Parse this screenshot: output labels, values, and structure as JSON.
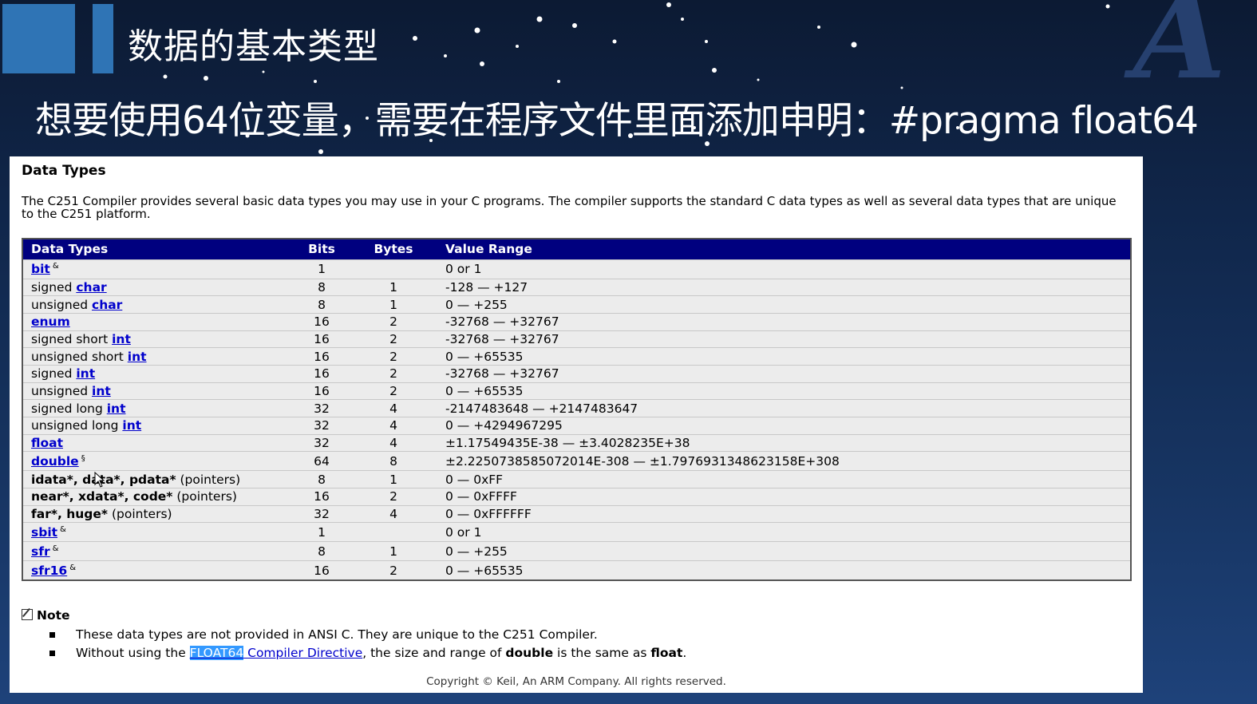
{
  "slide": {
    "title": "数据的基本类型",
    "subtitle": "想要使用64位变量，需要在程序文件里面添加申明：#pragma float64"
  },
  "doc": {
    "heading": "Data Types",
    "intro": "The C251 Compiler provides several basic data types you may use in your C programs. The compiler supports the standard C data types as well as several data types that are unique to the C251 platform.",
    "columns": [
      "Data Types",
      "Bits",
      "Bytes",
      "Value Range"
    ],
    "rows": [
      {
        "pre": "",
        "link": "bit",
        "post": "",
        "sup": "&",
        "bits": "1",
        "bytes": "",
        "range": "0 or 1"
      },
      {
        "pre": "signed ",
        "link": "char",
        "post": "",
        "sup": "",
        "bits": "8",
        "bytes": "1",
        "range": "-128 — +127"
      },
      {
        "pre": "unsigned ",
        "link": "char",
        "post": "",
        "sup": "",
        "bits": "8",
        "bytes": "1",
        "range": "0 — +255"
      },
      {
        "pre": "",
        "link": "enum",
        "post": "",
        "sup": "",
        "bits": "16",
        "bytes": "2",
        "range": "-32768 — +32767"
      },
      {
        "pre": "signed short ",
        "link": "int",
        "post": "",
        "sup": "",
        "bits": "16",
        "bytes": "2",
        "range": "-32768 — +32767"
      },
      {
        "pre": "unsigned short ",
        "link": "int",
        "post": "",
        "sup": "",
        "bits": "16",
        "bytes": "2",
        "range": "0 — +65535"
      },
      {
        "pre": "signed ",
        "link": "int",
        "post": "",
        "sup": "",
        "bits": "16",
        "bytes": "2",
        "range": "-32768 — +32767"
      },
      {
        "pre": "unsigned ",
        "link": "int",
        "post": "",
        "sup": "",
        "bits": "16",
        "bytes": "2",
        "range": "0 — +65535"
      },
      {
        "pre": "signed long ",
        "link": "int",
        "post": "",
        "sup": "",
        "bits": "32",
        "bytes": "4",
        "range": "-2147483648 — +2147483647"
      },
      {
        "pre": "unsigned long ",
        "link": "int",
        "post": "",
        "sup": "",
        "bits": "32",
        "bytes": "4",
        "range": "0 — +4294967295"
      },
      {
        "pre": "",
        "link": "float",
        "post": "",
        "sup": "",
        "bits": "32",
        "bytes": "4",
        "range": "±1.17549435E-38 — ±3.4028235E+38"
      },
      {
        "pre": "",
        "link": "double",
        "post": "",
        "sup": "§",
        "bits": "64",
        "bytes": "8",
        "range": "±2.2250738585072014E-308 — ±1.7976931348623158E+308"
      },
      {
        "bold": "idata*, data*, pdata*",
        "post": " (pointers)",
        "bits": "8",
        "bytes": "1",
        "range": "0 — 0xFF"
      },
      {
        "bold": "near*, xdata*, code*",
        "post": " (pointers)",
        "bits": "16",
        "bytes": "2",
        "range": "0 — 0xFFFF"
      },
      {
        "bold": "far*, huge*",
        "post": " (pointers)",
        "bits": "32",
        "bytes": "4",
        "range": "0 — 0xFFFFFF"
      },
      {
        "pre": "",
        "link": "sbit",
        "post": "",
        "sup": "&",
        "bits": "1",
        "bytes": "",
        "range": "0 or 1"
      },
      {
        "pre": "",
        "link": "sfr",
        "post": "",
        "sup": "&",
        "bits": "8",
        "bytes": "1",
        "range": "0 — +255"
      },
      {
        "pre": "",
        "link": "sfr16",
        "post": "",
        "sup": "&",
        "bits": "16",
        "bytes": "2",
        "range": "0 — +65535"
      }
    ],
    "note": {
      "label": "Note",
      "item1": "These data types are not provided in ANSI C. They are unique to the C251 Compiler.",
      "item2_pre": "Without using the ",
      "item2_link_hl": "FLOAT64",
      "item2_link_rest": " Compiler Directive",
      "item2_mid": ", the size and range of ",
      "item2_b1": "double",
      "item2_mid2": " is the same as ",
      "item2_b2": "float",
      "item2_end": "."
    },
    "copyright": "Copyright © Keil, An ARM Company. All rights reserved."
  },
  "colors": {
    "header_bg": "#00007f",
    "row_bg": "#ececec",
    "link": "#0000cc",
    "accent_square": "#2f74b5"
  }
}
